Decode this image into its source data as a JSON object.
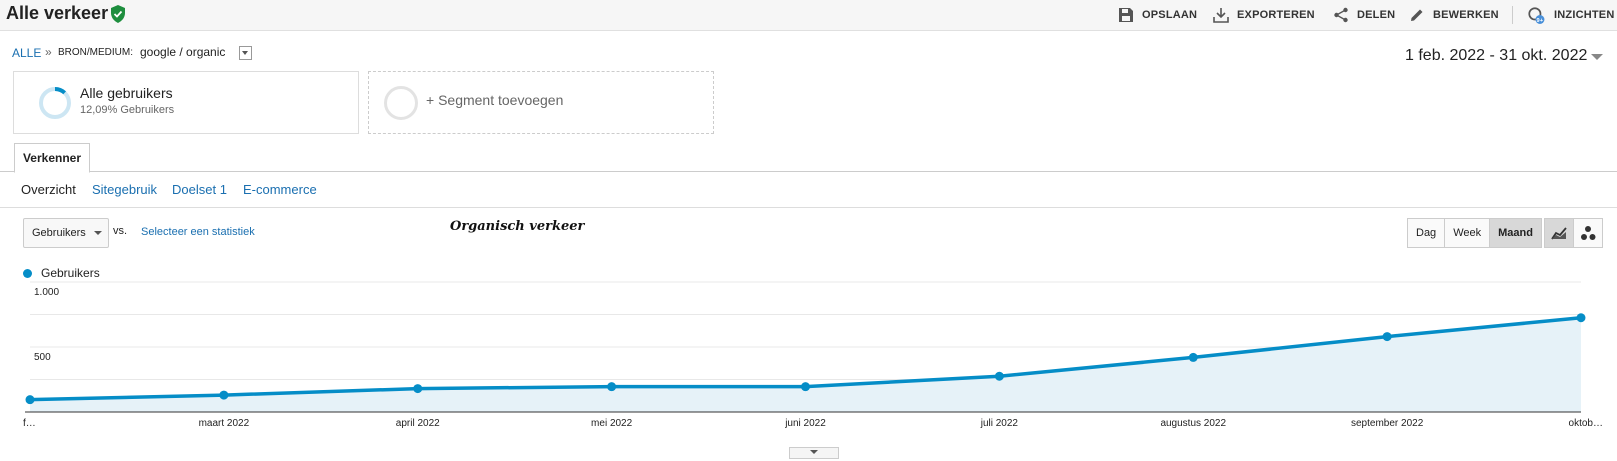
{
  "header": {
    "title": "Alle verkeer",
    "tools": [
      {
        "label": "OPSLAAN",
        "icon": "save-icon"
      },
      {
        "label": "EXPORTEREN",
        "icon": "download-icon"
      },
      {
        "label": "DELEN",
        "icon": "share-icon"
      },
      {
        "label": "BEWERKEN",
        "icon": "pencil-icon"
      },
      {
        "label": "INZICHTEN",
        "icon": "insights-icon",
        "badge": "9+"
      }
    ]
  },
  "breadcrumb": {
    "root": "ALLE",
    "separator": "»",
    "dimension_label": "BRON/MEDIUM:",
    "dimension_value": "google / organic"
  },
  "date_range": "1 feb. 2022 - 31 okt. 2022",
  "segments": {
    "active": {
      "name": "Alle gebruikers",
      "sub": "12,09% Gebruikers",
      "fraction": 0.1209
    },
    "add_label": "+ Segment toevoegen"
  },
  "tabs": [
    "Verkenner"
  ],
  "subnav": [
    {
      "label": "Overzicht",
      "active": true
    },
    {
      "label": "Sitegebruik",
      "active": false
    },
    {
      "label": "Doelset 1",
      "active": false
    },
    {
      "label": "E-commerce",
      "active": false
    }
  ],
  "controls": {
    "metric": "Gebruikers",
    "vs": "vs.",
    "select_metric": "Selecteer een statistiek",
    "chart_title": "Organisch verkeer",
    "periods": [
      {
        "label": "Dag",
        "active": false
      },
      {
        "label": "Week",
        "active": false
      },
      {
        "label": "Maand",
        "active": true
      }
    ]
  },
  "colors": {
    "series": "#058dc7",
    "area": "#e6f2f8",
    "link": "#1a6fb0",
    "verified": "#1e8e3e"
  },
  "chart_data": {
    "type": "area",
    "legend": "Gebruikers",
    "x": [
      "f…",
      "maart 2022",
      "april 2022",
      "mei 2022",
      "juni 2022",
      "juli 2022",
      "augustus 2022",
      "september 2022",
      "oktob…"
    ],
    "series": [
      {
        "name": "Gebruikers",
        "values": [
          95,
          130,
          180,
          195,
          195,
          275,
          420,
          580,
          725
        ]
      }
    ],
    "y_ticks": [
      {
        "value": 500,
        "label": "500"
      },
      {
        "value": 1000,
        "label": "1.000"
      }
    ],
    "ylim": [
      0,
      1000
    ],
    "grid": true
  }
}
